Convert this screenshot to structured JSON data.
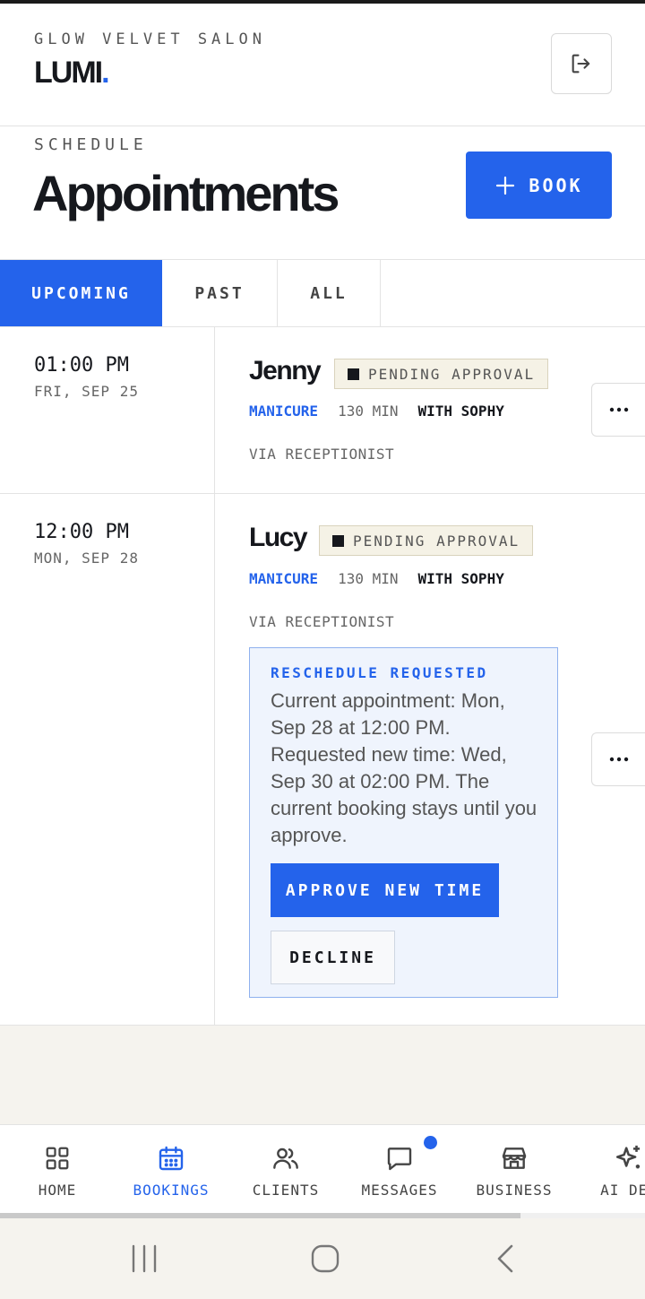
{
  "header": {
    "salon_name": "GLOW VELVET SALON",
    "brand": "LUMI",
    "brand_dot": ".",
    "logout_icon": "logout-icon"
  },
  "title_section": {
    "eyebrow": "SCHEDULE",
    "title": "Appointments",
    "book_label": "BOOK",
    "book_icon": "plus-icon"
  },
  "tabs": [
    {
      "label": "UPCOMING",
      "active": true
    },
    {
      "label": "PAST",
      "active": false
    },
    {
      "label": "ALL",
      "active": false
    }
  ],
  "appointments": [
    {
      "time": "01:00 PM",
      "date": "FRI, SEP 25",
      "client": "Jenny",
      "status": "PENDING APPROVAL",
      "service": "MANICURE",
      "duration": "130 MIN",
      "staff": "WITH SOPHY",
      "source": "VIA RECEPTIONIST"
    },
    {
      "time": "12:00 PM",
      "date": "MON, SEP 28",
      "client": "Lucy",
      "status": "PENDING APPROVAL",
      "service": "MANICURE",
      "duration": "130 MIN",
      "staff": "WITH SOPHY",
      "source": "VIA RECEPTIONIST",
      "reschedule": {
        "title": "RESCHEDULE REQUESTED",
        "text": "Current appointment: Mon, Sep 28 at 12:00 PM. Requested new time: Wed, Sep 30 at 02:00 PM. The current booking stays until you approve.",
        "approve_label": "APPROVE NEW TIME",
        "decline_label": "DECLINE"
      }
    }
  ],
  "bottom_nav": [
    {
      "label": "HOME",
      "icon": "grid-icon",
      "active": false
    },
    {
      "label": "BOOKINGS",
      "icon": "calendar-icon",
      "active": true
    },
    {
      "label": "CLIENTS",
      "icon": "users-icon",
      "active": false
    },
    {
      "label": "MESSAGES",
      "icon": "message-icon",
      "active": false,
      "has_notification": true
    },
    {
      "label": "BUSINESS",
      "icon": "store-icon",
      "active": false
    },
    {
      "label": "AI DES",
      "icon": "sparkles-icon",
      "active": false
    }
  ],
  "colors": {
    "accent": "#2463eb",
    "text": "#16181d",
    "background": "#f5f3ee",
    "badge_bg": "#f5f2e6"
  }
}
